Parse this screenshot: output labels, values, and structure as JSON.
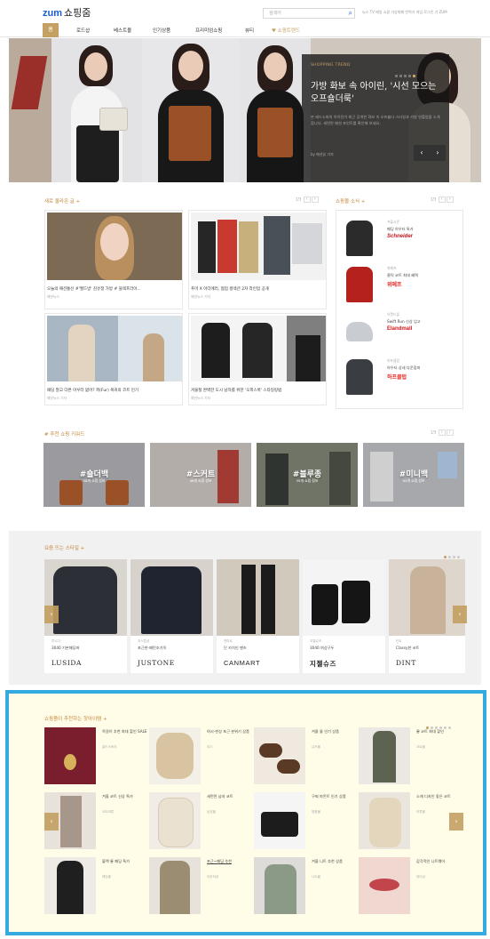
{
  "header": {
    "logo_brand": "zum",
    "logo_suffix": "쇼핑줌",
    "search_placeholder": "검색어",
    "utils": "뉴스  TV  메일  쇼핑  가상화폐  번역기  게임  로그인  기  ZUM"
  },
  "nav": {
    "home": "홈",
    "items": [
      "로드샵",
      "베스트몰",
      "인기상품",
      "프리미엄쇼핑",
      "뷰티",
      "♥ 쇼핑트렌드"
    ]
  },
  "hero": {
    "label": "SHOPPING TREND",
    "title": "가방 화보 속 아이린, '시선 모으는 오프숄더룩'",
    "desc": "본 레드소파의 아이린이 최근 공개한 화보 속 오프숄더 스타일과 가방 연출법을 소개합니다. 세련된 패션 포인트를 확인해 보세요.",
    "by": "by 패션뷰 기자",
    "prev": "‹",
    "next": "›"
  },
  "new_posts": {
    "title": "새로 올라온 글 +",
    "page": "1/3",
    "items": [
      {
        "title": "오늘의 패션통신 #'월드방' 김유정 가방 # 블랙프라이...",
        "sub": "패션뉴스"
      },
      {
        "title": "푸마 X 아더에러, 협업 컬렉션 2차 라인업 공개",
        "sub": "패션뉴스 기자"
      },
      {
        "title": "패딩 말고 다른 아우터 없어? 퍼(Fur) 복귀의 코트 인기",
        "sub": "패션뉴스 기자"
      },
      {
        "title": "겨울철 완벽한 도시 남자를 위한 '오피스룩' 스타일링법",
        "sub": "패션뉴스 기자"
      }
    ]
  },
  "mall_news": {
    "title": "쇼핑몰 소식 +",
    "page": "1/3",
    "items": [
      {
        "sub": "겨울시즌",
        "text": "패딩 아우터 특가",
        "logo": "Schneider"
      },
      {
        "sub": "위메프",
        "text": "클릭 코트 최대 혜택",
        "logo": "위메프"
      },
      {
        "sub": "이랜드몰",
        "text": "Swift Run 신상 입고",
        "logo": "Elandmall"
      },
      {
        "sub": "하프클럽",
        "text": "아우터 상세 다운점퍼",
        "logo": "하프클럽"
      }
    ]
  },
  "keywords": {
    "title": "# 추천 쇼핑 키워드",
    "page": "1/3",
    "items": [
      {
        "tag": "#숄더백",
        "sub": "58개 쇼핑 정보"
      },
      {
        "tag": "#스커트",
        "sub": "46개 쇼핑 정보"
      },
      {
        "tag": "#블루종",
        "sub": "35개 쇼핑 정보"
      },
      {
        "tag": "#미니백",
        "sub": "64개 쇼핑 정보"
      }
    ]
  },
  "trend_style": {
    "title": "요즘 뜨는 스타일 +",
    "items": [
      {
        "brand": "루시다",
        "name": "3040 기본패딩파",
        "logo": "LUSIDA"
      },
      {
        "brand": "저스톤샵",
        "name": "포근한-패턴조기옥",
        "logo": "JUSTONE"
      },
      {
        "brand": "캔마트",
        "name": "단 카치인 팬츠",
        "logo": "CANMART"
      },
      {
        "brand": "지젤슈즈",
        "name": "3040 여성구두",
        "logo": "지젤슈즈"
      },
      {
        "brand": "딘트",
        "name": "Classy한 코트",
        "logo": "DINT"
      }
    ]
  },
  "recommend": {
    "title": "쇼핑줌이 추천하는 핫아이템 +",
    "items": [
      {
        "text": "목걸이 추천 최대 할인 SALE",
        "brand": "골드스토리"
      },
      {
        "text": "여시-판상 포근 분위기 상품",
        "brand": "여시"
      },
      {
        "text": "겨울 뮬 인기 상품",
        "brand": "슈즈몰"
      },
      {
        "text": "롱 코트 최대 할인",
        "brand": "코트몰"
      },
      {
        "text": "겨울 코트 신상 특가",
        "brand": "코트의류"
      },
      {
        "text": "세련된 남자 코트",
        "brand": "남성몰"
      },
      {
        "text": "구찌 마몬트 인기 상품",
        "brand": "명품몰"
      },
      {
        "text": "소재 디자인 좋은 코트",
        "brand": "의류몰"
      },
      {
        "text": "블랙 롱 패딩 특가",
        "brand": "패딩몰"
      },
      {
        "text": "포근~패딩 추천",
        "brand": "아우터샵"
      },
      {
        "text": "겨울 니트 추천 상품",
        "brand": "니트몰"
      },
      {
        "text": "감각적인 니트웨어",
        "brand": "뷰티샵"
      }
    ]
  }
}
